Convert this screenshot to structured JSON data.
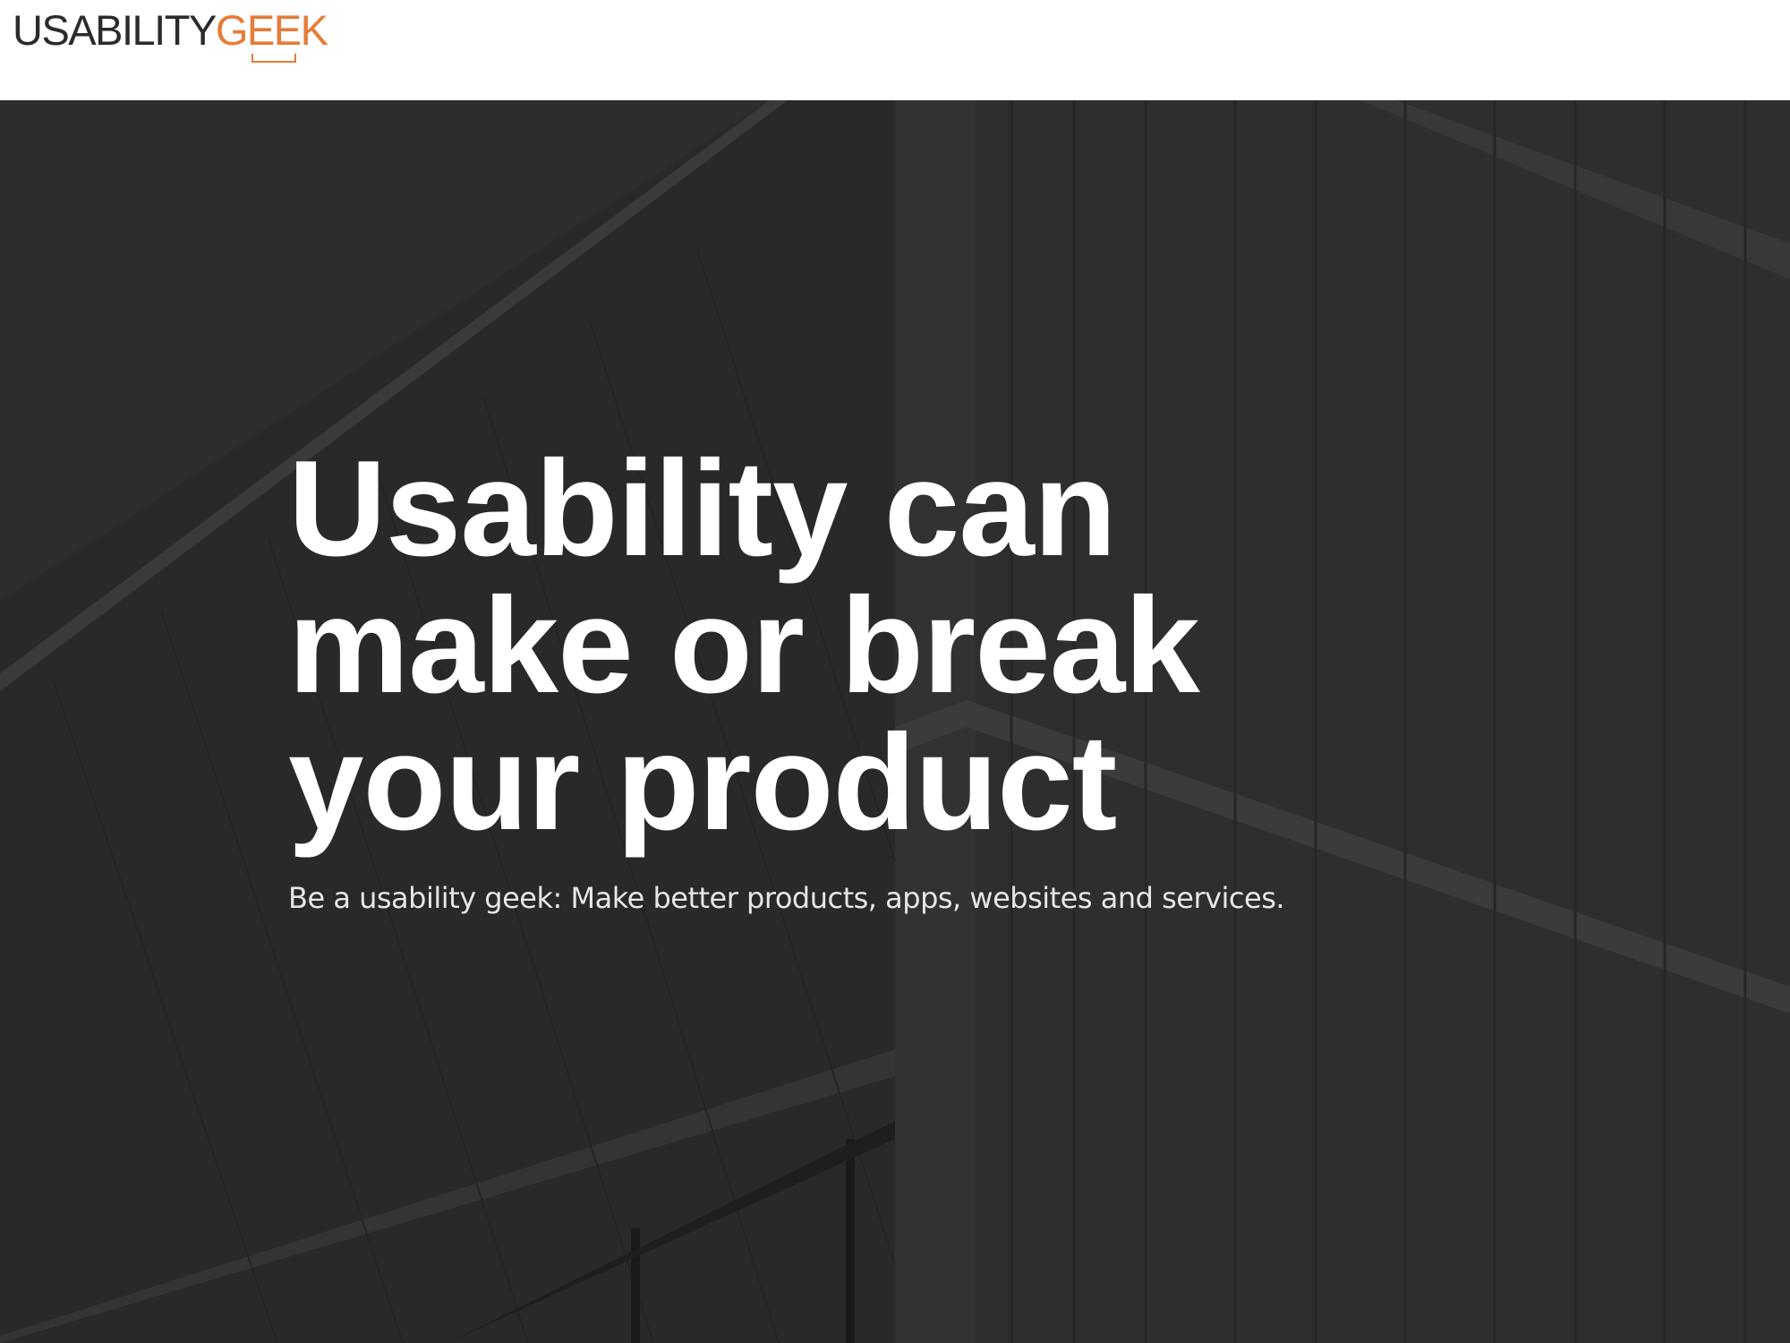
{
  "header": {
    "logo": {
      "part1": "USABILITY",
      "part2": "GEEK",
      "accent_color": "#e57c37"
    }
  },
  "hero": {
    "title": "Usability can\nmake or break\nyour product",
    "subtitle": "Be a usability geek: Make better products, apps, websites and services.",
    "background": "dark monochrome building facade photo",
    "background_color": "#2c2c2c"
  }
}
